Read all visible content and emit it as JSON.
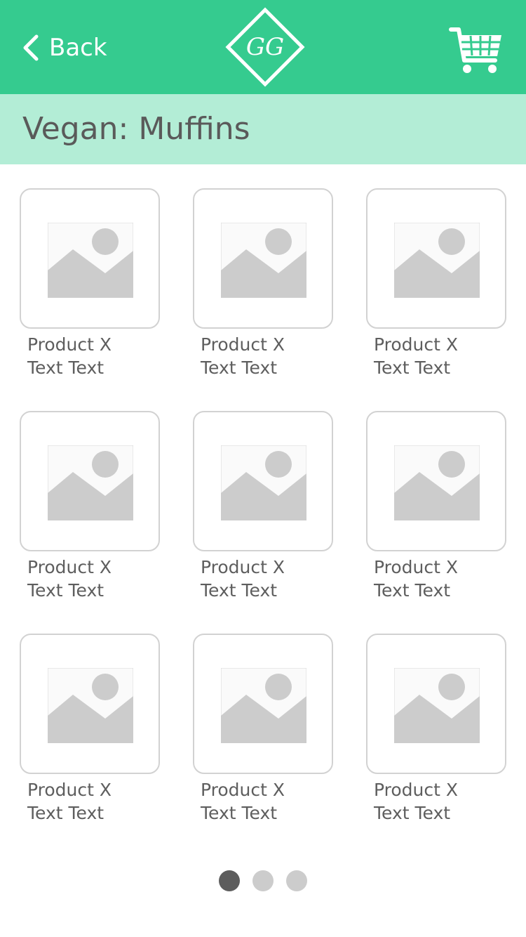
{
  "header": {
    "back_label": "Back",
    "logo_text": "GG",
    "back_icon": "chevron-left-icon",
    "cart_icon": "shopping-cart-icon",
    "colors": {
      "header_bg": "#35cb8f",
      "category_bg": "#b3edd6",
      "icon": "#ffffff"
    }
  },
  "category": {
    "title": "Vegan: Muffins"
  },
  "products": [
    {
      "name": "Product X",
      "desc": "Text Text",
      "icon": "image-placeholder-icon"
    },
    {
      "name": "Product X",
      "desc": "Text Text",
      "icon": "image-placeholder-icon"
    },
    {
      "name": "Product X",
      "desc": "Text Text",
      "icon": "image-placeholder-icon"
    },
    {
      "name": "Product X",
      "desc": "Text Text",
      "icon": "image-placeholder-icon"
    },
    {
      "name": "Product X",
      "desc": "Text Text",
      "icon": "image-placeholder-icon"
    },
    {
      "name": "Product X",
      "desc": "Text Text",
      "icon": "image-placeholder-icon"
    },
    {
      "name": "Product X",
      "desc": "Text Text",
      "icon": "image-placeholder-icon"
    },
    {
      "name": "Product X",
      "desc": "Text Text",
      "icon": "image-placeholder-icon"
    },
    {
      "name": "Product X",
      "desc": "Text Text",
      "icon": "image-placeholder-icon"
    }
  ],
  "pagination": {
    "page_count": 3,
    "current_page": 1
  }
}
